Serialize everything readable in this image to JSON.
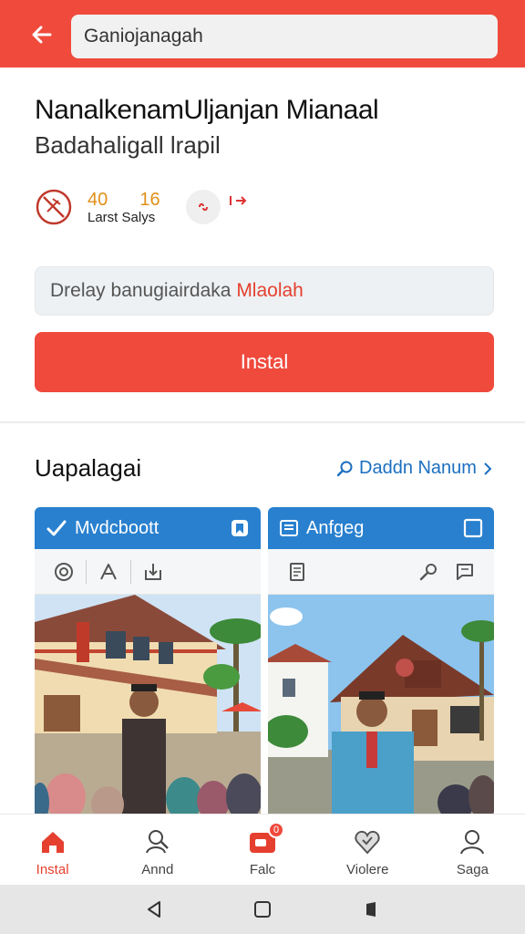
{
  "topbar": {
    "search_value": "Ganiojanagah",
    "color": "#ef4a3c"
  },
  "app": {
    "title": "NanalkenamUljanjan Mianaal",
    "subtitle": "Badahaligall lrapil",
    "stats": {
      "value_1": "40",
      "value_2": "16",
      "label_1": "Larst",
      "label_2": "Salys"
    },
    "info_text": "Drelay banugiairdaka",
    "info_highlight": "Mlaolah",
    "install_label": "Instal"
  },
  "section": {
    "title": "Uapalagai",
    "link_label": "Daddn Nanum"
  },
  "cards": [
    {
      "header_label": "Mvdcboott",
      "icons": [
        "check-icon",
        "bookmark-icon",
        "target-icon",
        "share-icon",
        "download-icon"
      ]
    },
    {
      "header_label": "Anfgeg",
      "icons": [
        "list-icon",
        "checkbox-icon",
        "document-icon",
        "search-icon",
        "comment-icon"
      ]
    }
  ],
  "bottom_nav": {
    "items": [
      {
        "label": "Instal",
        "icon": "home-icon",
        "active": true
      },
      {
        "label": "Annd",
        "icon": "people-search-icon",
        "active": false
      },
      {
        "label": "Falc",
        "icon": "video-icon",
        "active": false,
        "badge": "0"
      },
      {
        "label": "Violere",
        "icon": "heart-icon",
        "active": false
      },
      {
        "label": "Saga",
        "icon": "profile-icon",
        "active": false
      }
    ]
  },
  "colors": {
    "accent": "#ef4a3c",
    "blue": "#2980cf",
    "link": "#1b6fc0",
    "stat": "#e0901a"
  }
}
